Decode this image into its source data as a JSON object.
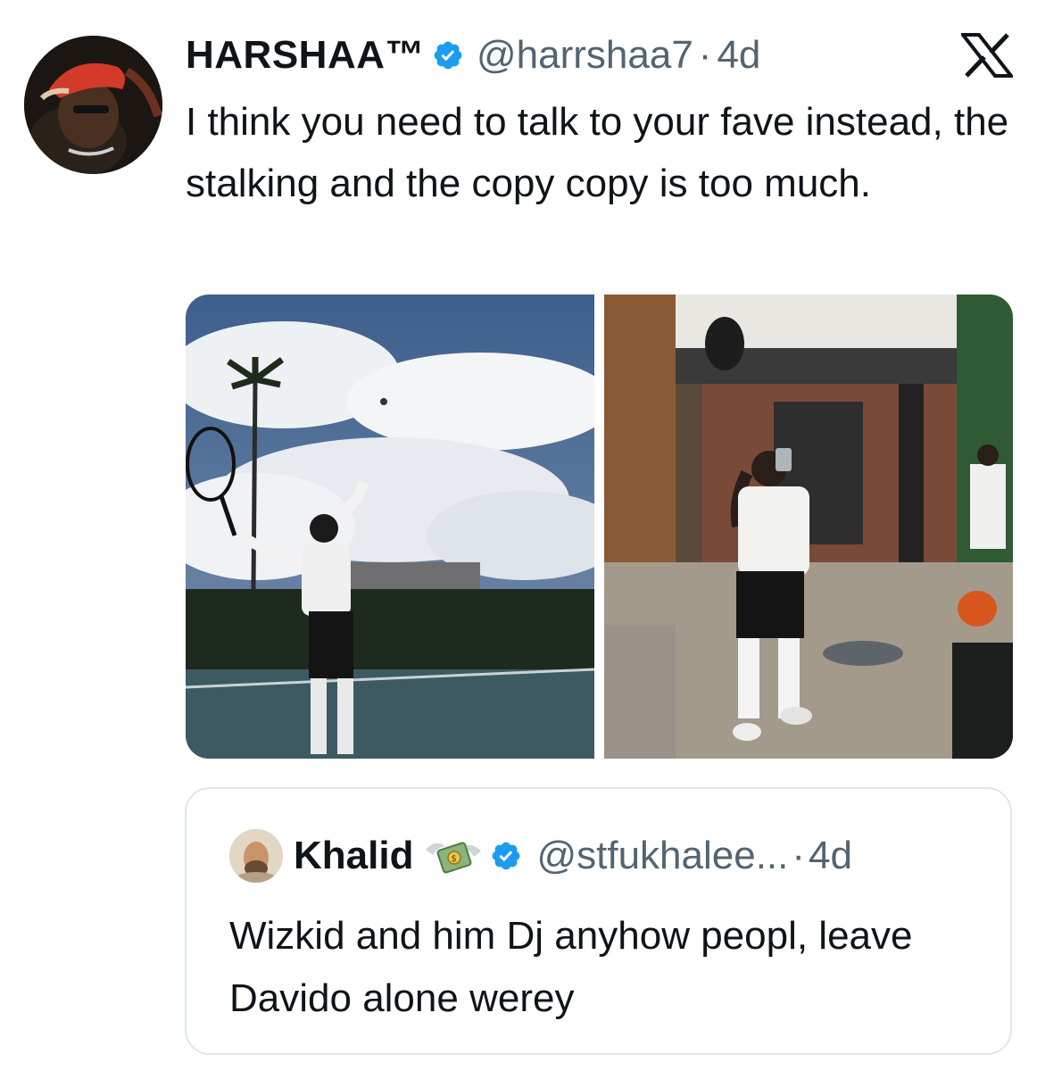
{
  "tweet": {
    "display_name": "HARSHAA™",
    "handle": "@harrshaa7",
    "separator": "·",
    "time": "4d",
    "text": "I think you need to talk to your fave instead, the stalking and the copy copy is too much.",
    "verified_icon": "verified-badge-icon",
    "platform_icon": "x-logo-icon",
    "media": [
      {
        "icon": "photo-tennis-serve"
      },
      {
        "icon": "photo-gym-mirror-selfie"
      }
    ]
  },
  "quote": {
    "display_name": "Khalid",
    "emoji": "money-with-wings",
    "handle": "@stfukhalee...",
    "separator": "·",
    "time": "4d",
    "text": "Wizkid and him Dj anyhow peopl, leave Davido alone werey"
  },
  "colors": {
    "verified_blue": "#1d9bf0",
    "text_primary": "#0f1419",
    "text_secondary": "#536471",
    "border": "#e1e6ea"
  }
}
